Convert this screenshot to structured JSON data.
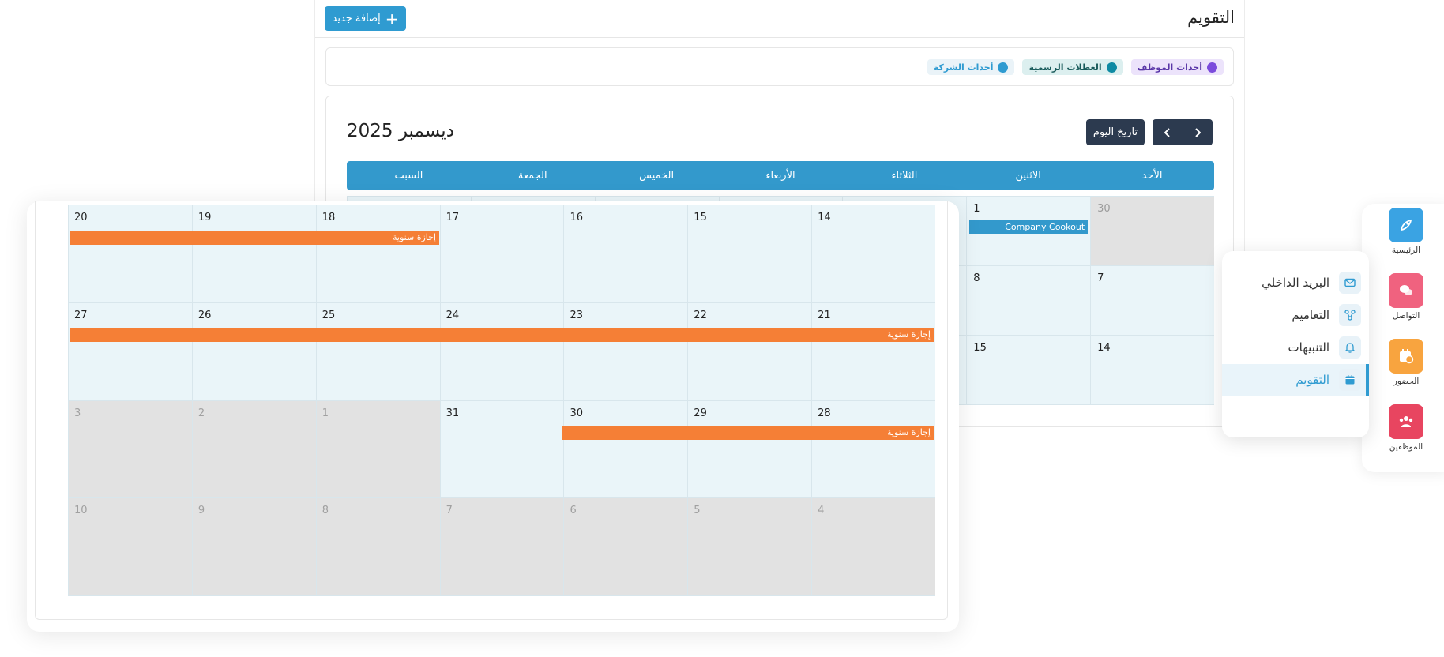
{
  "app": {
    "title": "التقويم",
    "add_button_label": "إضافة جديد",
    "add_icon": "plus-icon"
  },
  "legend": {
    "company": "أحداث الشركة",
    "holidays": "العطلات الرسمية",
    "employee": "أحداث الموظف"
  },
  "calendar": {
    "month_label": "ديسمبر 2025",
    "today_label": "تاريخ اليوم",
    "next_icon": "chevron-right-icon",
    "prev_icon": "chevron-left-icon",
    "weekdays": [
      "الأحد",
      "الاثنين",
      "الثلاثاء",
      "الأربعاء",
      "الخميس",
      "الجمعة",
      "السبت"
    ],
    "back_cells": {
      "c30": "30",
      "c1": "1",
      "c7": "7",
      "c8": "8",
      "c14": "14",
      "c15": "15"
    },
    "back_event": "Company Cookout"
  },
  "zoom": {
    "weeks": [
      [
        "14",
        "15",
        "16",
        "17",
        "18",
        "19",
        "20"
      ],
      [
        "21",
        "22",
        "23",
        "24",
        "25",
        "26",
        "27"
      ],
      [
        "28",
        "29",
        "30",
        "31",
        "1",
        "2",
        "3"
      ],
      [
        "4",
        "5",
        "6",
        "7",
        "8",
        "9",
        "10"
      ]
    ],
    "event_label": "إجازة سنوية"
  },
  "sidebar": {
    "items": [
      {
        "label": "الرئيسية",
        "color": "#3aa3e3",
        "icon": "rocket-icon"
      },
      {
        "label": "التواصل",
        "color": "#f0627f",
        "icon": "chat-bubbles-icon"
      },
      {
        "label": "الحضور",
        "color": "#f8a43f",
        "icon": "calendar-clock-icon"
      },
      {
        "label": "الموظفين",
        "color": "#e84560",
        "icon": "users-icon"
      }
    ]
  },
  "submenu": {
    "items": [
      {
        "label": "البريد الداخلي",
        "icon": "mail-icon"
      },
      {
        "label": "التعاميم",
        "icon": "share-icon"
      },
      {
        "label": "التنبيهات",
        "icon": "bell-icon"
      },
      {
        "label": "التقويم",
        "icon": "calendar-icon"
      }
    ]
  }
}
